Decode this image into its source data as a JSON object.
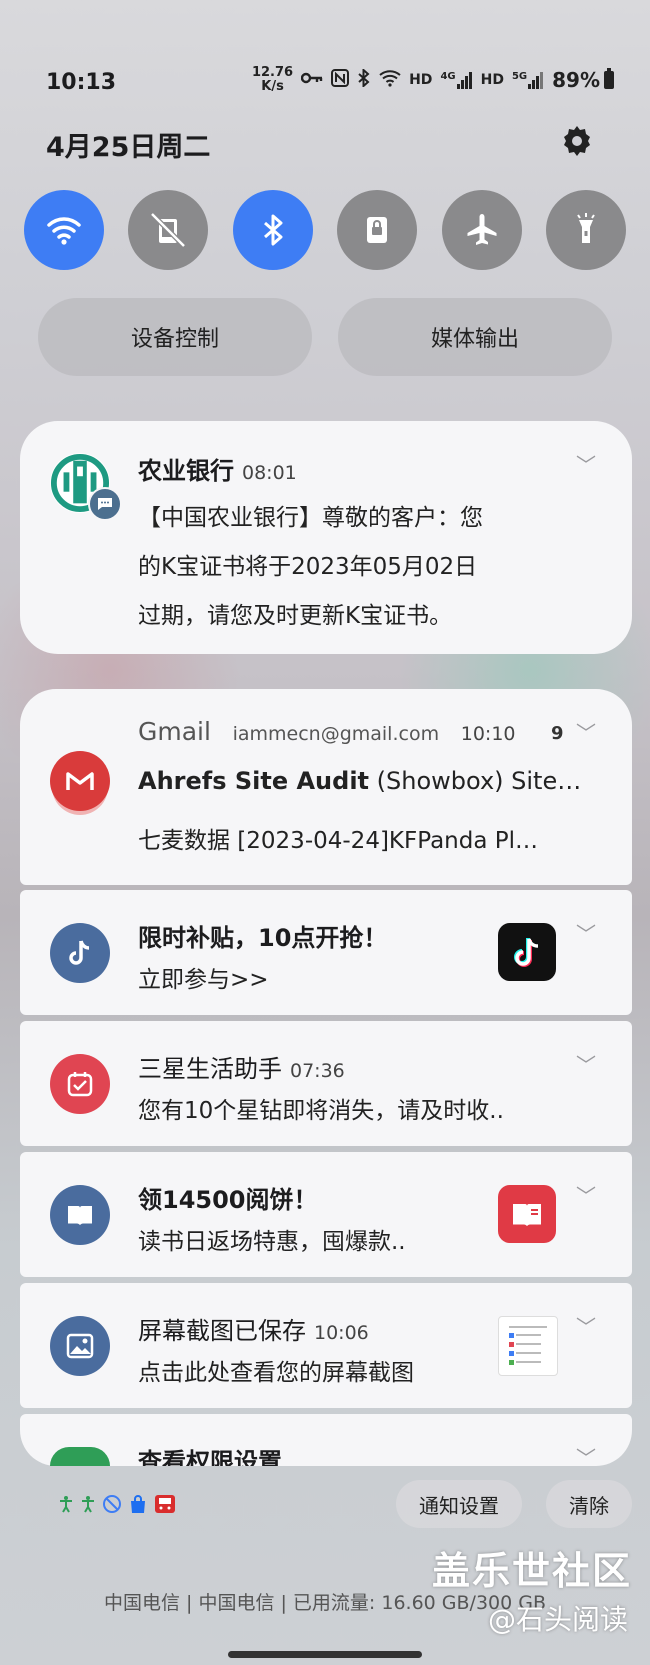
{
  "status_bar": {
    "time": "10:13",
    "speed_value": "12.76",
    "speed_unit": "K/s",
    "icons": [
      "key-icon",
      "nfc-icon",
      "bluetooth-icon",
      "wifi-icon",
      "hd-icon",
      "signal-4g-icon",
      "hd-icon",
      "signal-5g-icon"
    ],
    "hd1": "HD",
    "net1": "4G",
    "hd2": "HD",
    "net2": "5G",
    "battery": "89%"
  },
  "header": {
    "date": "4月25日周二"
  },
  "quick_settings": [
    {
      "name": "wifi",
      "state": "on"
    },
    {
      "name": "auto-rotate",
      "state": "off"
    },
    {
      "name": "bluetooth",
      "state": "on"
    },
    {
      "name": "screen-lock",
      "state": "off"
    },
    {
      "name": "airplane-mode",
      "state": "off"
    },
    {
      "name": "flashlight",
      "state": "off"
    }
  ],
  "pills": {
    "device_control": "设备控制",
    "media_output": "媒体输出"
  },
  "notifications": {
    "abc": {
      "app": "农业银行",
      "time": "08:01",
      "line1": "【中国农业银行】尊敬的客户：您",
      "line2": "的K宝证书将于2023年05月02日",
      "line3": "过期，请您及时更新K宝证书。"
    },
    "gmail": {
      "app": "Gmail",
      "account": "iammecn@gmail.com",
      "time": "10:10",
      "count": "9",
      "subject_bold": "Ahrefs Site Audit",
      "subject_rest": " (Showbox) Site…",
      "snippet": "七麦数据 [2023-04-24]KFPanda Pl…"
    },
    "douyin": {
      "title": "限时补贴，10点开抢！",
      "body": "立即参与>>"
    },
    "samsung": {
      "app": "三星生活助手",
      "time": "07:36",
      "body": "您有10个星钻即将消失，请及时收.."
    },
    "reader": {
      "title": "领14500阅饼！",
      "body": "读书日返场特惠，囤爆款.."
    },
    "screenshot": {
      "app": "屏幕截图已保存",
      "time": "10:06",
      "body": "点击此处查看您的屏幕截图"
    },
    "permissions": {
      "title": "查看权限设置"
    }
  },
  "footer": {
    "notification_settings": "通知设置",
    "clear": "清除",
    "carrier": "中国电信 | 中国电信 | 已用流量: 16.60 GB/300 GB"
  },
  "watermark": {
    "line1": "盖乐世社区",
    "line2": "@石头阅读"
  },
  "colors": {
    "accent": "#3e7df4",
    "abc_green": "#1e9a82",
    "gmail_red": "#d93b3b",
    "app_blue": "#4a6c9e",
    "samsung_red": "#e04552"
  }
}
